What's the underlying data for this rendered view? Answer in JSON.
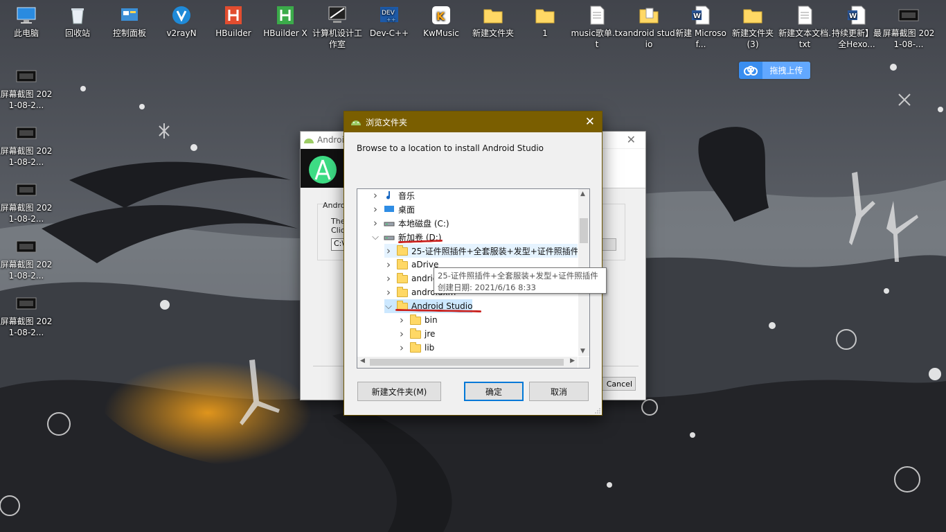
{
  "desktop": {
    "icons": [
      {
        "label": "此电脑",
        "icon": "computer-icon"
      },
      {
        "label": "回收站",
        "icon": "recycle-bin-icon"
      },
      {
        "label": "控制面板",
        "icon": "control-panel-icon"
      },
      {
        "label": "v2rayN",
        "icon": "v2rayn-icon"
      },
      {
        "label": "HBuilder",
        "icon": "hbuilder-icon"
      },
      {
        "label": "HBuilder X",
        "icon": "hbuilderx-icon"
      },
      {
        "label": "计算机设计工作室",
        "icon": "monitor-icon"
      },
      {
        "label": "Dev-C++",
        "icon": "devcpp-icon"
      },
      {
        "label": "KwMusic",
        "icon": "kwmusic-icon"
      },
      {
        "label": "新建文件夹",
        "icon": "folder-icon"
      },
      {
        "label": "1",
        "icon": "folder-icon"
      },
      {
        "label": "music歌单.txt",
        "icon": "text-file-icon"
      },
      {
        "label": "android studio",
        "icon": "folder-doc-icon"
      },
      {
        "label": "新建 Microsof...",
        "icon": "word-icon"
      },
      {
        "label": "新建文件夹 (3)",
        "icon": "folder-icon"
      },
      {
        "label": "新建文本文档.txt",
        "icon": "text-file-icon"
      },
      {
        "label": "持续更新】最全Hexo...",
        "icon": "word-icon"
      },
      {
        "label": "屏幕截图 2021-08-...",
        "icon": "screenshot-icon"
      }
    ],
    "left_icons": [
      {
        "label": "屏幕截图 2021-08-2..."
      },
      {
        "label": "屏幕截图 2021-08-2..."
      },
      {
        "label": "屏幕截图 2021-08-2..."
      },
      {
        "label": "屏幕截图 2021-08-2..."
      },
      {
        "label": "屏幕截图 2021-08-2..."
      }
    ],
    "upload_button": "拖拽上传"
  },
  "setup_dialog": {
    "title": "Androi",
    "group_label": "Androi",
    "line1": "The",
    "line2": "Click",
    "path": "C:\\",
    "cancel": "Cancel"
  },
  "browse_dialog": {
    "title": "浏览文件夹",
    "prompt": "Browse to a location to install Android Studio",
    "tree": [
      {
        "label": "音乐",
        "indent": 0,
        "chevron": "right",
        "icon": "music-note-icon"
      },
      {
        "label": "桌面",
        "indent": 0,
        "chevron": "right",
        "icon": "desktop-icon"
      },
      {
        "label": "本地磁盘 (C:)",
        "indent": 0,
        "chevron": "right",
        "icon": "drive-icon"
      },
      {
        "label": "新加卷 (D:)",
        "indent": 0,
        "chevron": "down",
        "icon": "drive-icon"
      },
      {
        "label": "25-证件照插件+全套服装+发型+证件照插件",
        "indent": 1,
        "chevron": "right",
        "icon": "folder-icon"
      },
      {
        "label": "aDrive",
        "indent": 1,
        "chevron": "right",
        "icon": "folder-icon"
      },
      {
        "label": "andrid",
        "indent": 1,
        "chevron": "right",
        "icon": "folder-icon"
      },
      {
        "label": "androidxm",
        "indent": 1,
        "chevron": "right",
        "icon": "folder-icon"
      },
      {
        "label": "Android Studio",
        "indent": 1,
        "chevron": "down",
        "icon": "folder-icon"
      },
      {
        "label": "bin",
        "indent": 2,
        "chevron": "right",
        "icon": "folder-icon"
      },
      {
        "label": "jre",
        "indent": 2,
        "chevron": "right",
        "icon": "folder-icon"
      },
      {
        "label": "lib",
        "indent": 2,
        "chevron": "right",
        "icon": "folder-icon"
      }
    ],
    "tooltip": {
      "line1": "25-证件照插件+全套服装+发型+证件照插件",
      "line2": "创建日期: 2021/6/16 8:33"
    },
    "buttons": {
      "new_folder": "新建文件夹(M)",
      "ok": "确定",
      "cancel": "取消"
    }
  },
  "colors": {
    "title_bar": "#7a5e00",
    "annotation_red": "#c9211e",
    "selection": "#cce8ff"
  }
}
